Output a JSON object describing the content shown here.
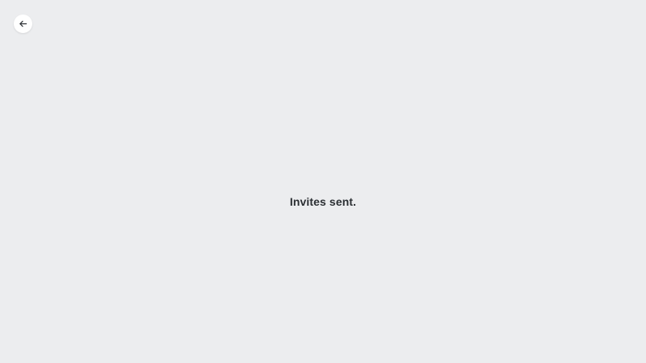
{
  "back": {
    "icon": "arrow-left-icon",
    "color": "#2b2f33"
  },
  "status": {
    "message": "Invites sent."
  },
  "colors": {
    "background": "#ecedef",
    "button_background": "#ffffff",
    "text": "#2b2f33"
  }
}
